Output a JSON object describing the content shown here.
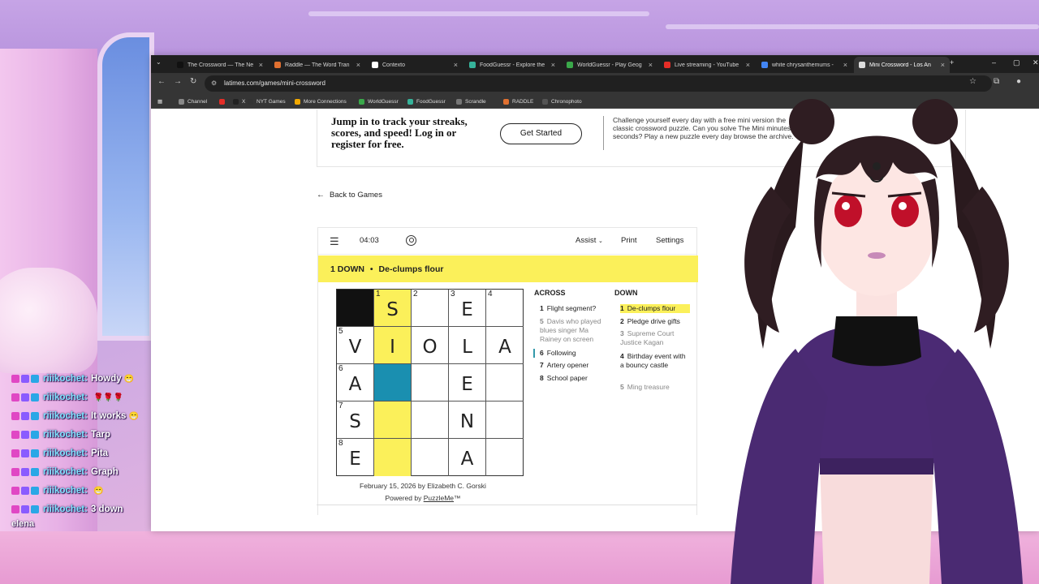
{
  "browser": {
    "tabs": [
      {
        "title": "The Crossword — The Ne",
        "color": "#111111"
      },
      {
        "title": "Raddle — The Word Tran",
        "color": "#e07030"
      },
      {
        "title": "Contexto",
        "color": "#ffffff"
      },
      {
        "title": "FoodGuessr - Explore the",
        "color": "#36b39a"
      },
      {
        "title": "WorldGuessr - Play Geog",
        "color": "#3aa84a"
      },
      {
        "title": "Live streaming - YouTube",
        "color": "#e52d27"
      },
      {
        "title": "white chrysanthemums -",
        "color": "#4285f4"
      },
      {
        "title": "Mini Crossword - Los An",
        "color": "#dddddd"
      }
    ],
    "url": "latimes.com/games/mini-crossword",
    "bookmarks": [
      {
        "label": "Channel",
        "color": "#888888"
      },
      {
        "label": "",
        "color": "#e52d27"
      },
      {
        "label": "X",
        "color": "#222222"
      },
      {
        "label": "NYT Games",
        "color": "#333333"
      },
      {
        "label": "More Connections",
        "color": "#f2a900"
      },
      {
        "label": "WorldGuessr",
        "color": "#3aa84a"
      },
      {
        "label": "FoodGuessr",
        "color": "#36b39a"
      },
      {
        "label": "Scrandle",
        "color": "#777777"
      },
      {
        "label": "RADDLE",
        "color": "#e07030"
      },
      {
        "label": "Chronophoto",
        "color": "#555555"
      }
    ]
  },
  "promo": {
    "heading": "Jump in to track your streaks, scores, and speed! Log in or register for free.",
    "button": "Get Started",
    "description": "Challenge yourself every day with a free mini version the classic crossword puzzle. Can you solve The Mini minutes — or seconds? Play a new puzzle every day browse the archive."
  },
  "nav": {
    "back": "Back to Games"
  },
  "toolbar": {
    "timer": "04:03",
    "assist": "Assist",
    "print": "Print",
    "settings": "Settings"
  },
  "current_clue": {
    "ref": "1 DOWN",
    "separator": "•",
    "text": "De-clumps flour"
  },
  "grid": {
    "rows": [
      [
        {
          "black": true
        },
        {
          "num": "1",
          "letter": "S",
          "state": "yellow"
        },
        {
          "num": "2",
          "letter": ""
        },
        {
          "num": "3",
          "letter": "E"
        },
        {
          "num": "4",
          "letter": ""
        }
      ],
      [
        {
          "num": "5",
          "letter": "V"
        },
        {
          "letter": "I",
          "state": "yellow"
        },
        {
          "letter": "O"
        },
        {
          "letter": "L"
        },
        {
          "letter": "A"
        }
      ],
      [
        {
          "num": "6",
          "letter": "A"
        },
        {
          "letter": "",
          "state": "active"
        },
        {
          "letter": ""
        },
        {
          "letter": "E"
        },
        {
          "letter": ""
        }
      ],
      [
        {
          "num": "7",
          "letter": "S"
        },
        {
          "letter": "",
          "state": "yellow"
        },
        {
          "letter": ""
        },
        {
          "letter": "N"
        },
        {
          "letter": ""
        }
      ],
      [
        {
          "num": "8",
          "letter": "E"
        },
        {
          "letter": "",
          "state": "yellow"
        },
        {
          "letter": ""
        },
        {
          "letter": "A"
        },
        {
          "letter": ""
        }
      ]
    ]
  },
  "clues": {
    "across_head": "ACROSS",
    "down_head": "DOWN",
    "across": [
      {
        "n": "1",
        "text": "Flight segment?"
      },
      {
        "n": "5",
        "text": "Davis who played blues singer Ma Rainey on screen",
        "faded": true
      },
      {
        "n": "6",
        "text": "Following",
        "focus": true
      },
      {
        "n": "7",
        "text": "Artery opener"
      },
      {
        "n": "8",
        "text": "School paper"
      }
    ],
    "down": [
      {
        "n": "1",
        "text": "De-clumps flour",
        "highlight": true
      },
      {
        "n": "2",
        "text": "Pledge drive gifts"
      },
      {
        "n": "3",
        "text": "Supreme Court Justice Kagan",
        "faded": true
      },
      {
        "n": "4",
        "text": "Birthday event with a bouncy castle"
      },
      {
        "n": "5",
        "text": "Ming treasure",
        "faded": true
      }
    ]
  },
  "footer": {
    "byline": "February 15, 2026 by Elizabeth C. Gorski",
    "powered_prefix": "Powered by ",
    "powered_link": "PuzzleMe",
    "powered_suffix": "™"
  },
  "chat": {
    "messages": [
      {
        "user": "riiikochet:",
        "text": "Howdy",
        "emoji": "😁"
      },
      {
        "user": "riiikochet:",
        "text": "",
        "emoji": "🌹🌹🌹"
      },
      {
        "user": "riiikochet:",
        "text": "It works",
        "emoji": "😁"
      },
      {
        "user": "riiikochet:",
        "text": "Tarp",
        "emoji": ""
      },
      {
        "user": "riiikochet:",
        "text": "Pita",
        "emoji": ""
      },
      {
        "user": "riiikochet:",
        "text": "Graph",
        "emoji": ""
      },
      {
        "user": "riiikochet:",
        "text": "",
        "emoji": "😁"
      },
      {
        "user": "riiikochet:",
        "text": "3 down",
        "emoji": ""
      }
    ],
    "footer": "elena"
  }
}
